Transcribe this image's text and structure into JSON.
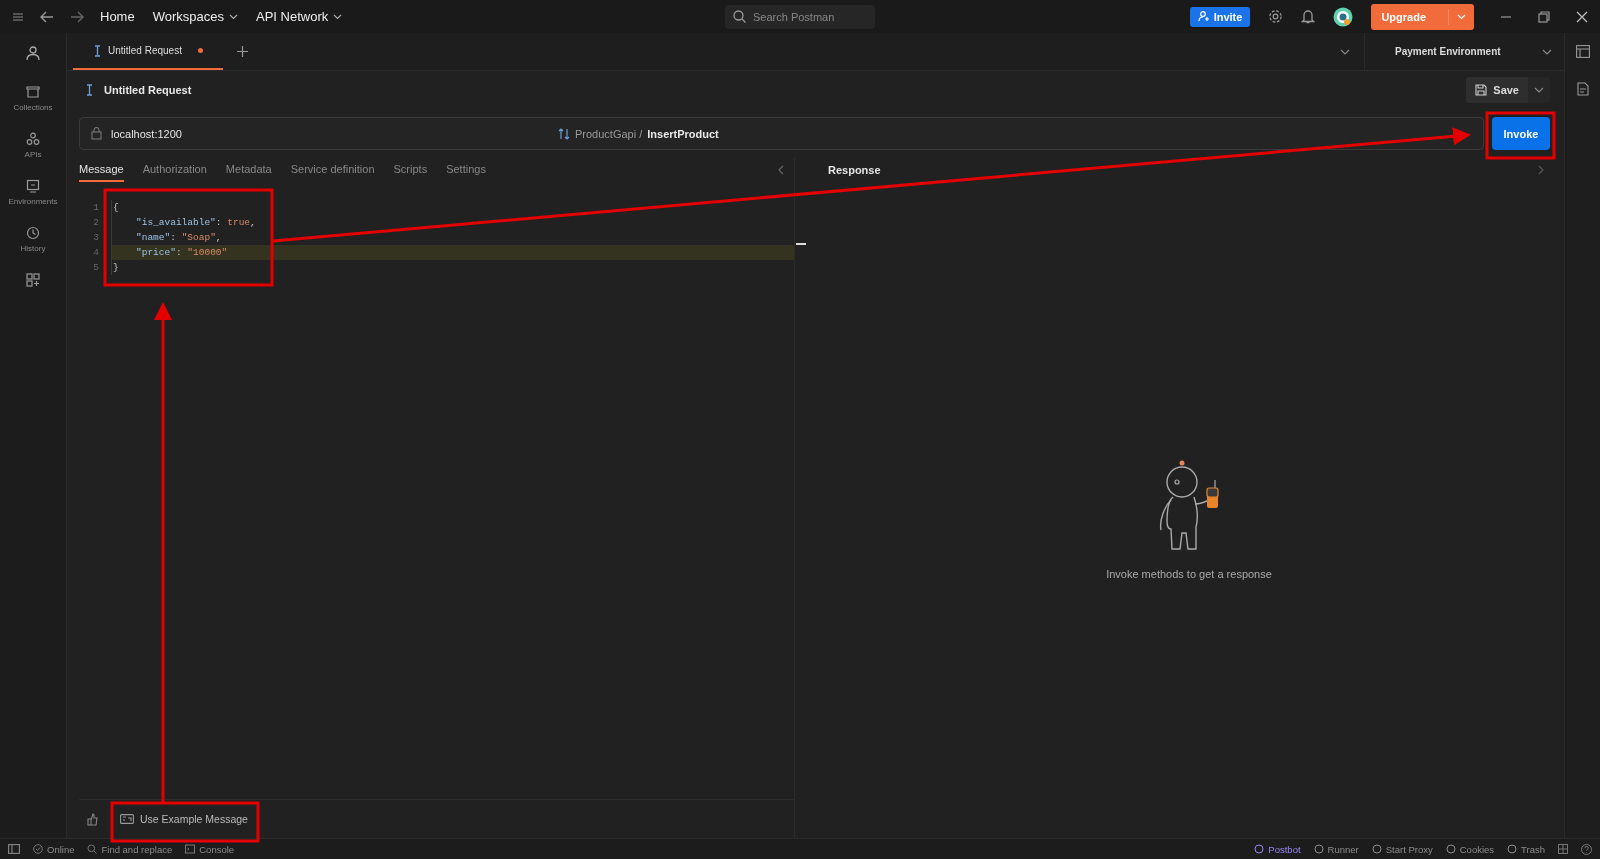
{
  "topbar": {
    "nav": [
      {
        "label": "Home",
        "dropdown": false
      },
      {
        "label": "Workspaces",
        "dropdown": true
      },
      {
        "label": "API Network",
        "dropdown": true
      }
    ],
    "search": {
      "placeholder": "Search Postman"
    },
    "invite": "Invite",
    "upgrade": "Upgrade"
  },
  "sidebar": {
    "items": [
      {
        "label": "Collections"
      },
      {
        "label": "APIs"
      },
      {
        "label": "Environments"
      },
      {
        "label": "History"
      }
    ]
  },
  "tabs": [
    {
      "label": "Untitled Request",
      "selected": true,
      "unsaved": true
    }
  ],
  "environment": "Payment Environment",
  "request": {
    "title": "Untitled Request",
    "save": "Save",
    "url": "localhost:1200",
    "service": "ProductGapi",
    "separator": "/",
    "method": "InsertProduct",
    "invoke": "Invoke"
  },
  "subtabs": [
    {
      "label": "Message",
      "selected": true
    },
    {
      "label": "Authorization",
      "selected": false
    },
    {
      "label": "Metadata",
      "selected": false
    },
    {
      "label": "Service definition",
      "selected": false
    },
    {
      "label": "Scripts",
      "selected": false
    },
    {
      "label": "Settings",
      "selected": false
    }
  ],
  "editor": {
    "lines": [
      {
        "number": "1",
        "active": false,
        "indented": false,
        "tokens": [
          {
            "kind": "punct",
            "text": "{"
          }
        ]
      },
      {
        "number": "2",
        "active": false,
        "indented": true,
        "tokens": [
          {
            "kind": "key",
            "text": "\"is_available\""
          },
          {
            "kind": "punct",
            "text": ": "
          },
          {
            "kind": "bool",
            "text": "true"
          },
          {
            "kind": "punct",
            "text": ","
          }
        ]
      },
      {
        "number": "3",
        "active": false,
        "indented": true,
        "tokens": [
          {
            "kind": "key",
            "text": "\"name\""
          },
          {
            "kind": "punct",
            "text": ": "
          },
          {
            "kind": "string",
            "text": "\"Soap\""
          },
          {
            "kind": "punct",
            "text": ","
          }
        ]
      },
      {
        "number": "4",
        "active": true,
        "indented": true,
        "tokens": [
          {
            "kind": "key",
            "text": "\"price\""
          },
          {
            "kind": "punct",
            "text": ": "
          },
          {
            "kind": "string",
            "text": "\"10000\""
          }
        ]
      },
      {
        "number": "5",
        "active": false,
        "indented": false,
        "tokens": [
          {
            "kind": "punct",
            "text": "}"
          }
        ]
      }
    ]
  },
  "response": {
    "title": "Response",
    "empty_message": "Invoke methods to get a response"
  },
  "footer": {
    "example": "Use Example Message"
  },
  "status_bar": {
    "left": [
      {
        "label": "Online"
      },
      {
        "label": "Find and replace"
      },
      {
        "label": "Console"
      }
    ],
    "right": [
      {
        "label": "Postbot",
        "color": "#9b87f5"
      },
      {
        "label": "Runner",
        "color": "#8c8c8c"
      },
      {
        "label": "Start Proxy",
        "color": "#8c8c8c"
      },
      {
        "label": "Cookies",
        "color": "#8c8c8c"
      },
      {
        "label": "Trash",
        "color": "#8c8c8c"
      }
    ]
  }
}
